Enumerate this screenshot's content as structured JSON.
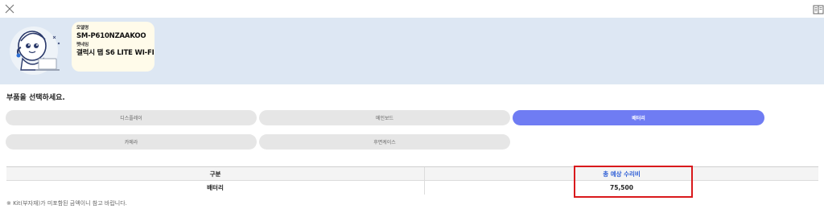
{
  "header": {
    "model_label": "모델명",
    "model_value": "SM-P610NZAAKOO",
    "pet_label": "펫네임",
    "pet_value": "갤럭시 탭 S6 LITE WI-FI"
  },
  "parts": {
    "title": "부품을 선택하세요.",
    "items": [
      {
        "label": "디스플레이",
        "active": false
      },
      {
        "label": "메인보드",
        "active": false
      },
      {
        "label": "배터리",
        "active": true
      },
      {
        "label": "카메라",
        "active": false
      },
      {
        "label": "후면케이스",
        "active": false
      }
    ]
  },
  "table": {
    "headers": [
      "구분",
      "총 예상 수리비"
    ],
    "rows": [
      [
        "배터리",
        "75,500"
      ]
    ]
  },
  "footnote": "※ Kit(부자재)가 미포함된 금액이니 참고 바랍니다.",
  "colors": {
    "active_button": "#6f7cf3",
    "header_bg": "#dde7f3",
    "highlight": "#d9191c",
    "total_label": "#2f5fd6"
  }
}
